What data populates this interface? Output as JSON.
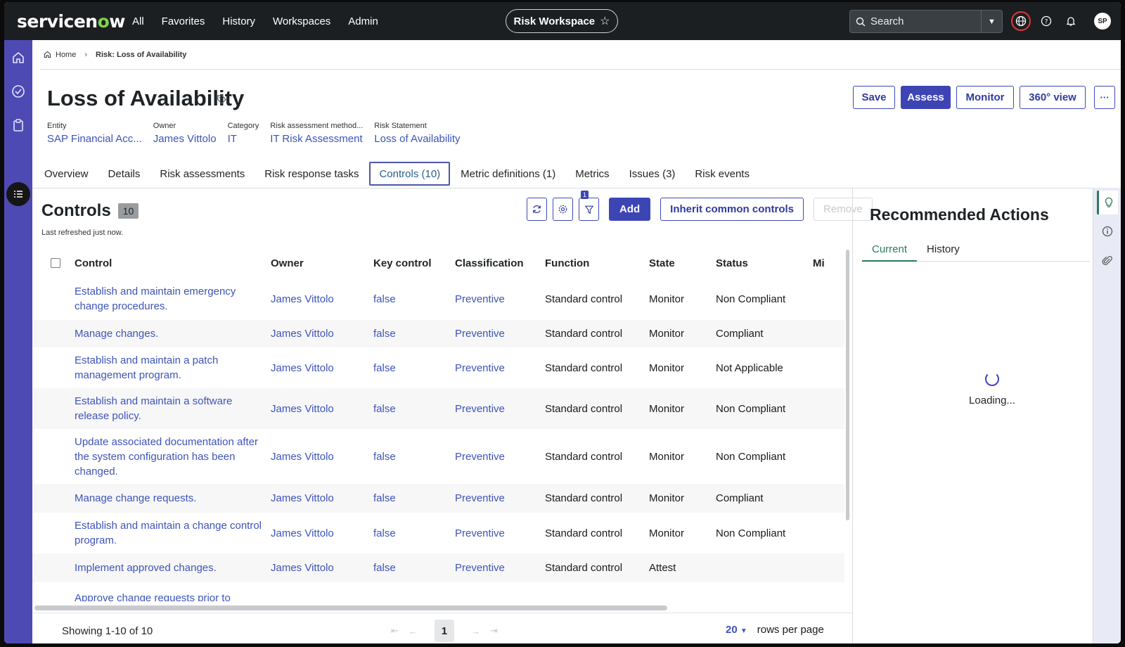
{
  "nav": {
    "logo_pre": "servicen",
    "logo_o": "o",
    "logo_post": "w",
    "links": [
      "All",
      "Favorites",
      "History",
      "Workspaces",
      "Admin"
    ],
    "workspace": "Risk Workspace",
    "search_placeholder": "Search",
    "avatar": "SP"
  },
  "breadcrumb": {
    "home": "Home",
    "current": "Risk: Loss of Availability"
  },
  "record": {
    "title": "Loss of Availability",
    "fields": [
      {
        "label": "Entity",
        "value": "SAP Financial Acc..."
      },
      {
        "label": "Owner",
        "value": "James Vittolo"
      },
      {
        "label": "Category",
        "value": "IT"
      },
      {
        "label": "Risk assessment method...",
        "value": "IT Risk Assessment"
      },
      {
        "label": "Risk Statement",
        "value": "Loss of Availability"
      }
    ],
    "actions": {
      "save": "Save",
      "assess": "Assess",
      "monitor": "Monitor",
      "view360": "360° view",
      "more": "···"
    }
  },
  "tabs": [
    "Overview",
    "Details",
    "Risk assessments",
    "Risk response tasks",
    "Controls (10)",
    "Metric definitions (1)",
    "Metrics",
    "Issues (3)",
    "Risk events"
  ],
  "controls": {
    "title": "Controls",
    "count": "10",
    "refreshed": "Last refreshed just now.",
    "filter_badge": "1",
    "add": "Add",
    "inherit": "Inherit common controls",
    "remove": "Remove",
    "columns": [
      "Control",
      "Owner",
      "Key control",
      "Classification",
      "Function",
      "State",
      "Status",
      "Mi"
    ],
    "rows": [
      {
        "control": "Establish and maintain emergency change procedures.",
        "owner": "James Vittolo",
        "key": "false",
        "classification": "Preventive",
        "function": "Standard control",
        "state": "Monitor",
        "status": "Non Compliant"
      },
      {
        "control": "Manage changes.",
        "owner": "James Vittolo",
        "key": "false",
        "classification": "Preventive",
        "function": "Standard control",
        "state": "Monitor",
        "status": "Compliant"
      },
      {
        "control": "Establish and maintain a patch management program.",
        "owner": "James Vittolo",
        "key": "false",
        "classification": "Preventive",
        "function": "Standard control",
        "state": "Monitor",
        "status": "Not Applicable"
      },
      {
        "control": "Establish and maintain a software release policy.",
        "owner": "James Vittolo",
        "key": "false",
        "classification": "Preventive",
        "function": "Standard control",
        "state": "Monitor",
        "status": "Non Compliant"
      },
      {
        "control": "Update associated documentation after the system configuration has been changed.",
        "owner": "James Vittolo",
        "key": "false",
        "classification": "Preventive",
        "function": "Standard control",
        "state": "Monitor",
        "status": "Non Compliant"
      },
      {
        "control": "Manage change requests.",
        "owner": "James Vittolo",
        "key": "false",
        "classification": "Preventive",
        "function": "Standard control",
        "state": "Monitor",
        "status": "Compliant"
      },
      {
        "control": "Establish and maintain a change control program.",
        "owner": "James Vittolo",
        "key": "false",
        "classification": "Preventive",
        "function": "Standard control",
        "state": "Monitor",
        "status": "Non Compliant"
      },
      {
        "control": "Implement approved changes.",
        "owner": "James Vittolo",
        "key": "false",
        "classification": "Preventive",
        "function": "Standard control",
        "state": "Attest",
        "status": ""
      },
      {
        "control": "Approve change requests prior to",
        "owner": "",
        "key": "",
        "classification": "",
        "function": "",
        "state": "",
        "status": ""
      }
    ]
  },
  "footer": {
    "showing": "Showing 1-10 of 10",
    "page": "1",
    "rows_per_page_value": "20",
    "rows_per_page_label": "rows per page"
  },
  "recommended": {
    "title": "Recommended Actions",
    "tabs": [
      "Current",
      "History"
    ],
    "loading": "Loading..."
  }
}
